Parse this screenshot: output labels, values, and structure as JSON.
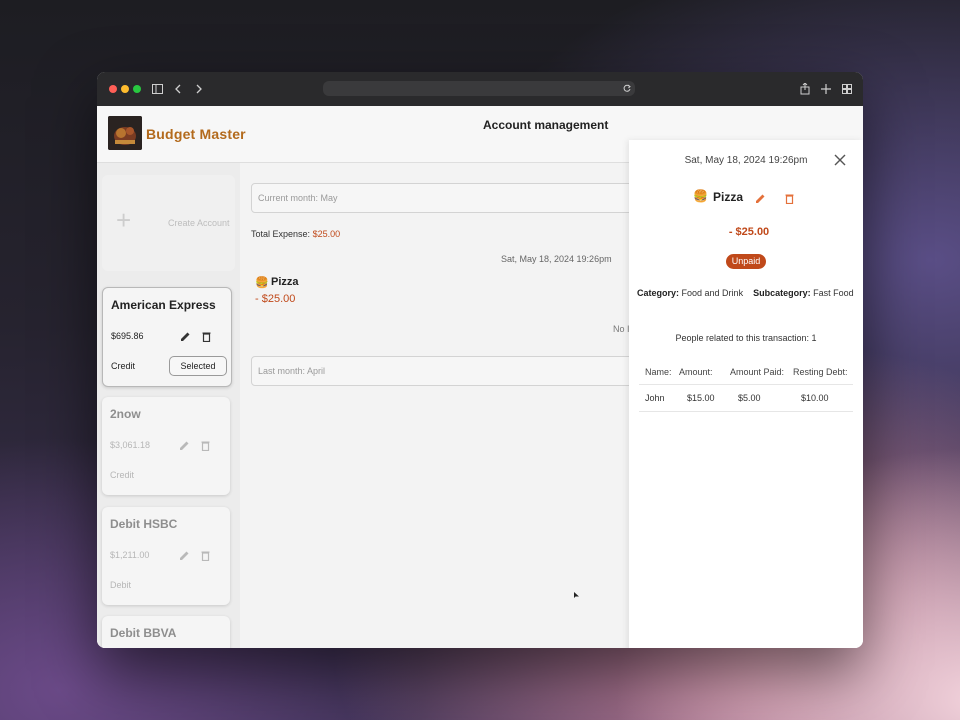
{
  "browser": {
    "address": "",
    "dots": [
      "#ff5f57",
      "#febc2e",
      "#28c840"
    ]
  },
  "app": {
    "name": "Budget Master",
    "page_title": "Account management"
  },
  "sidebar": {
    "create_label": "Create Account",
    "accounts": [
      {
        "name": "American Express",
        "balance": "$695.86",
        "type": "Credit",
        "selected_label": "Selected",
        "selected": true
      },
      {
        "name": "2now",
        "balance": "$3,061.18",
        "type": "Credit",
        "selected": false
      },
      {
        "name": "Debit HSBC",
        "balance": "$1,211.00",
        "type": "Debit",
        "selected": false
      },
      {
        "name": "Debit BBVA",
        "selected": false
      }
    ]
  },
  "main": {
    "current_month": "Current month: May",
    "total_label": "Total Expense:",
    "total_value": "$25.00",
    "tx_date": "Sat, May 18, 2024 19:26pm",
    "tx_name": "Pizza",
    "tx_amount": "- $25.00",
    "no_text": "No I",
    "last_month": "Last month: April"
  },
  "detail": {
    "date": "Sat, May 18, 2024 19:26pm",
    "name": "Pizza",
    "amount": "- $25.00",
    "status": "Unpaid",
    "category_label": "Category:",
    "category": "Food and Drink",
    "subcategory_label": "Subcategory:",
    "subcategory": "Fast Food",
    "people_text": "People related to this transaction: 1",
    "columns": [
      "Name:",
      "Amount:",
      "Amount Paid:",
      "Resting Debt:"
    ],
    "rows": [
      [
        "John",
        "$15.00",
        "$5.00",
        "$10.00"
      ]
    ]
  },
  "colors": {
    "accent": "#c0491a",
    "brand": "#b36a1c"
  }
}
